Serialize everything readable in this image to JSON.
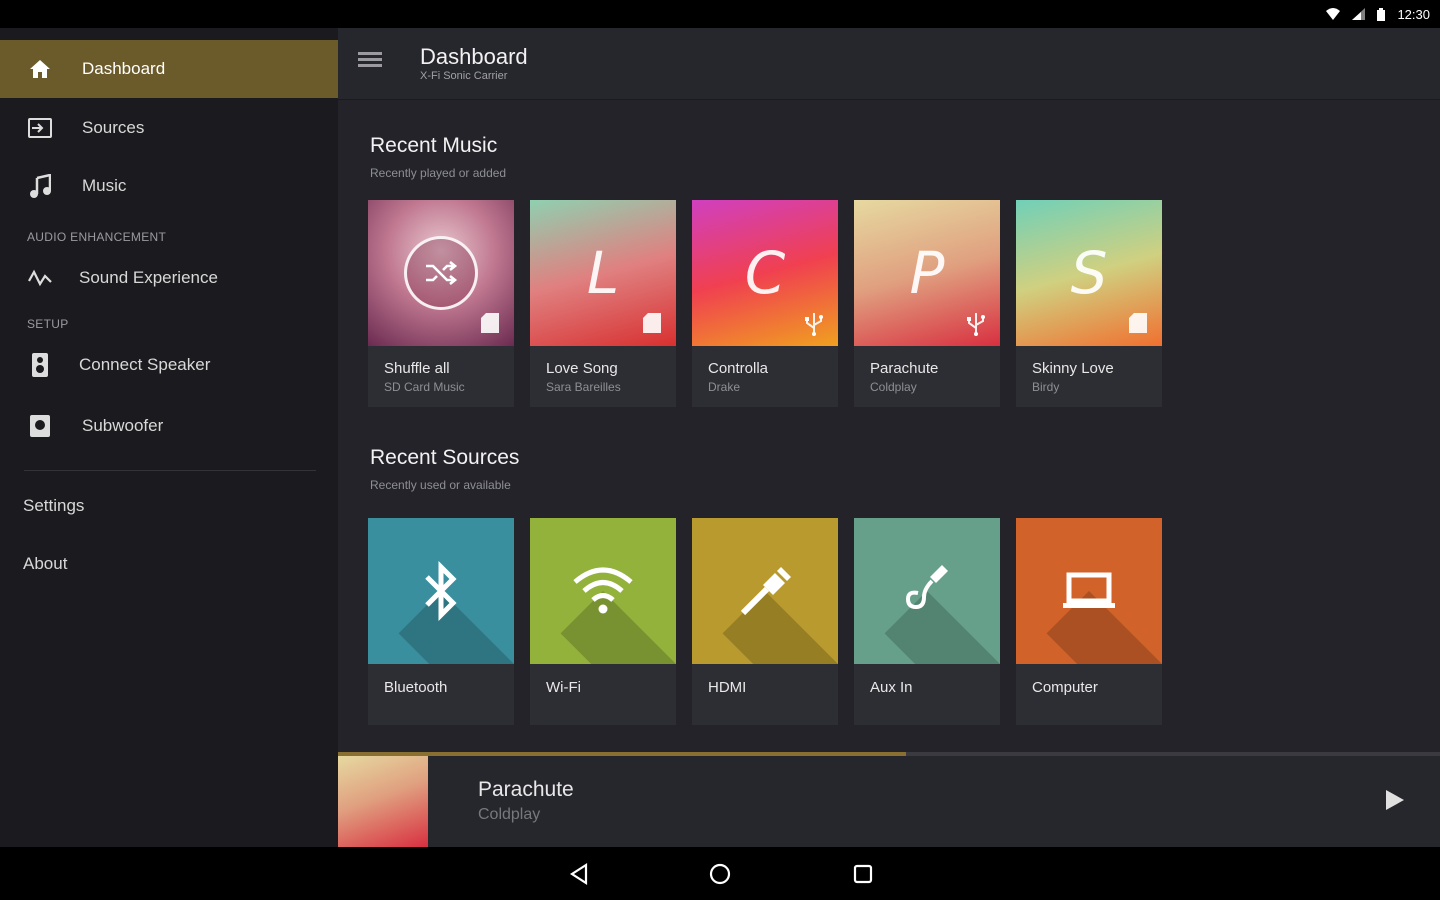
{
  "status": {
    "time": "12:30"
  },
  "drawer": {
    "items": [
      {
        "label": "Dashboard",
        "icon": "home-icon"
      },
      {
        "label": "Sources",
        "icon": "input-icon"
      },
      {
        "label": "Music",
        "icon": "music-note-icon"
      }
    ],
    "sections": [
      {
        "header": "AUDIO ENHANCEMENT",
        "items": [
          {
            "label": "Sound Experience",
            "icon": "waveform-icon"
          }
        ]
      },
      {
        "header": "SETUP",
        "items": [
          {
            "label": "Connect Speaker",
            "icon": "speaker-icon"
          },
          {
            "label": "Subwoofer",
            "icon": "subwoofer-icon"
          }
        ]
      }
    ],
    "footer": [
      {
        "label": "Settings"
      },
      {
        "label": "About"
      }
    ]
  },
  "toolbar": {
    "title": "Dashboard",
    "subtitle": "X-Fi Sonic Carrier"
  },
  "recent_music": {
    "title": "Recent Music",
    "subtitle": "Recently played or added",
    "cards": [
      {
        "title": "Shuffle all",
        "subtitle": "SD Card Music",
        "letter": "",
        "badge": "sd-card-icon",
        "colors": [
          "#7a3a5a",
          "#e0b0b8",
          "#c08080"
        ]
      },
      {
        "title": "Love Song",
        "subtitle": "Sara Bareilles",
        "letter": "L",
        "badge": "sd-card-icon",
        "colors": [
          "#8fd0b0",
          "#e08080",
          "#d83030"
        ]
      },
      {
        "title": "Controlla",
        "subtitle": "Drake",
        "letter": "C",
        "badge": "usb-icon",
        "colors": [
          "#d040c0",
          "#f04050",
          "#f0a020"
        ]
      },
      {
        "title": "Parachute",
        "subtitle": "Coldplay",
        "letter": "P",
        "badge": "usb-icon",
        "colors": [
          "#e6d9a0",
          "#e0a080",
          "#d83040"
        ]
      },
      {
        "title": "Skinny Love",
        "subtitle": "Birdy",
        "letter": "S",
        "badge": "sd-card-icon",
        "colors": [
          "#70d0b8",
          "#d0d080",
          "#f07030"
        ]
      }
    ]
  },
  "recent_sources": {
    "title": "Recent Sources",
    "subtitle": "Recently used or available",
    "cards": [
      {
        "title": "Bluetooth",
        "icon": "bluetooth-icon",
        "color": "#3a8f9e"
      },
      {
        "title": "Wi-Fi",
        "icon": "wifi-icon",
        "color": "#93b23c"
      },
      {
        "title": "HDMI",
        "icon": "hdmi-icon",
        "color": "#b89a2e"
      },
      {
        "title": "Aux In",
        "icon": "aux-cable-icon",
        "color": "#66a08a"
      },
      {
        "title": "Computer",
        "icon": "laptop-icon",
        "color": "#d0622a"
      }
    ]
  },
  "player": {
    "title": "Parachute",
    "artist": "Coldplay",
    "progress": 0.515
  },
  "accent": "#6b5a2a"
}
